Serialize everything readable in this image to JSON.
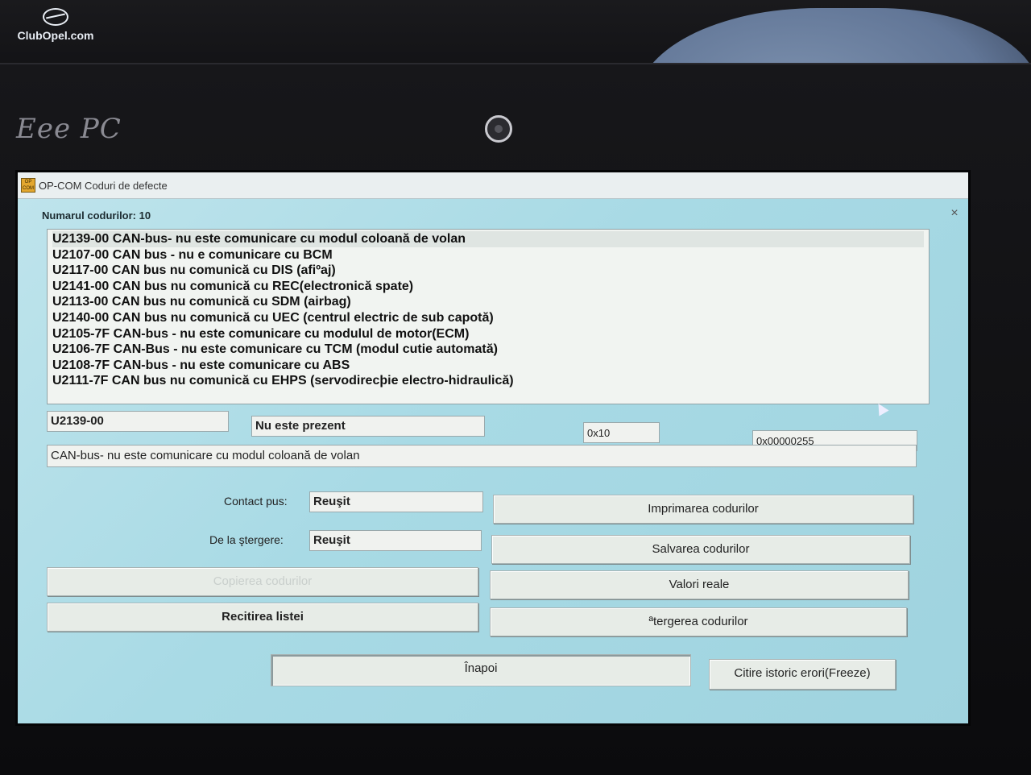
{
  "watermark": "ClubOpel.com",
  "laptop": {
    "brand": "Eee PC"
  },
  "window": {
    "icon_text": "OP COM",
    "title": "OP-COM   Coduri de defecte",
    "close_symbol": "×"
  },
  "codes": {
    "count_label": "Numarul codurilor: 10",
    "items": [
      "U2139-00 CAN-bus- nu este comunicare cu modul coloană de volan",
      "U2107-00 CAN bus - nu e comunicare cu BCM",
      "U2117-00 CAN bus nu comunică cu DIS (afiºaj)",
      "U2141-00 CAN bus nu comunică cu REC(electronică spate)",
      "U2113-00 CAN bus nu comunică cu  SDM (airbag)",
      "U2140-00 CAN bus nu comunică cu UEC (centrul electric de sub capotă)",
      "U2105-7F CAN-bus - nu este comunicare cu modulul de motor(ECM)",
      "U2106-7F CAN-Bus - nu este comunicare cu TCM (modul cutie automată)",
      "U2108-7F CAN-bus - nu este comunicare cu ABS",
      "U2111-7F CAN bus nu comunică cu EHPS (servodirecþie electro-hidraulică)"
    ]
  },
  "details": {
    "code": "U2139-00",
    "status": "Nu este prezent",
    "hex1": "0x10",
    "hex2": "0x00000255",
    "description": "CAN-bus- nu este comunicare cu modul coloană de volan"
  },
  "status_fields": {
    "contact_label": "Contact pus:",
    "contact_value": "Reuşit",
    "erase_label": "De la ştergere:",
    "erase_value": "Reuşit"
  },
  "buttons": {
    "print": "Imprimarea codurilor",
    "save": "Salvarea codurilor",
    "copy": "Copierea codurilor",
    "real_values": "Valori reale",
    "reread": "Recitirea listei",
    "erase": "ªtergerea codurilor",
    "back": "Înapoi",
    "freeze": "Citire istoric erori(Freeze)"
  }
}
